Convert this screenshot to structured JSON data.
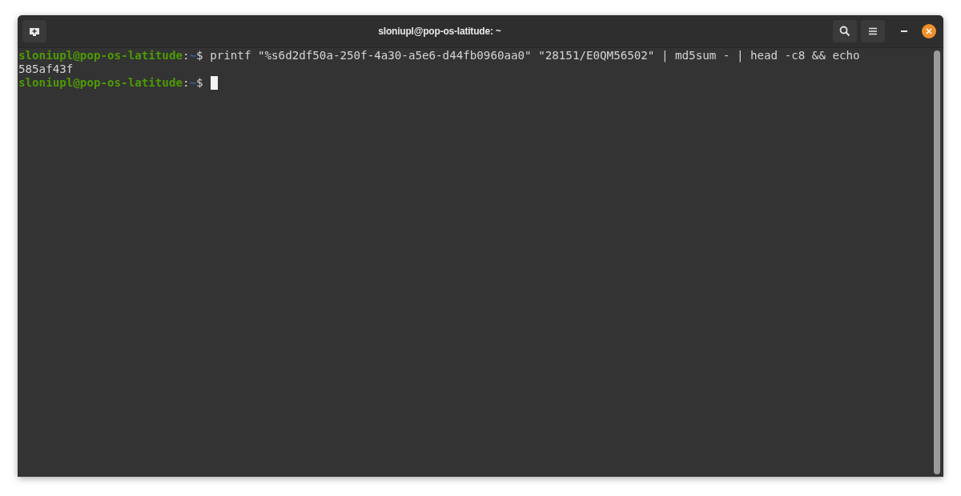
{
  "window": {
    "title": "sloniupl@pop-os-latitude: ~"
  },
  "terminal": {
    "lines": [
      {
        "kind": "prompt",
        "user_host": "sloniupl@pop-os-latitude",
        "separator": ":",
        "path": "~",
        "symbol": "$",
        "command": "printf \"%s6d2df50a-250f-4a30-a5e6-d44fb0960aa0\" \"28151/E0QM56502\" | md5sum - | head -c8 && echo",
        "cursor": false
      },
      {
        "kind": "output",
        "text": "585af43f"
      },
      {
        "kind": "prompt",
        "user_host": "sloniupl@pop-os-latitude",
        "separator": ":",
        "path": "~",
        "symbol": "$",
        "cursor": true
      }
    ]
  }
}
